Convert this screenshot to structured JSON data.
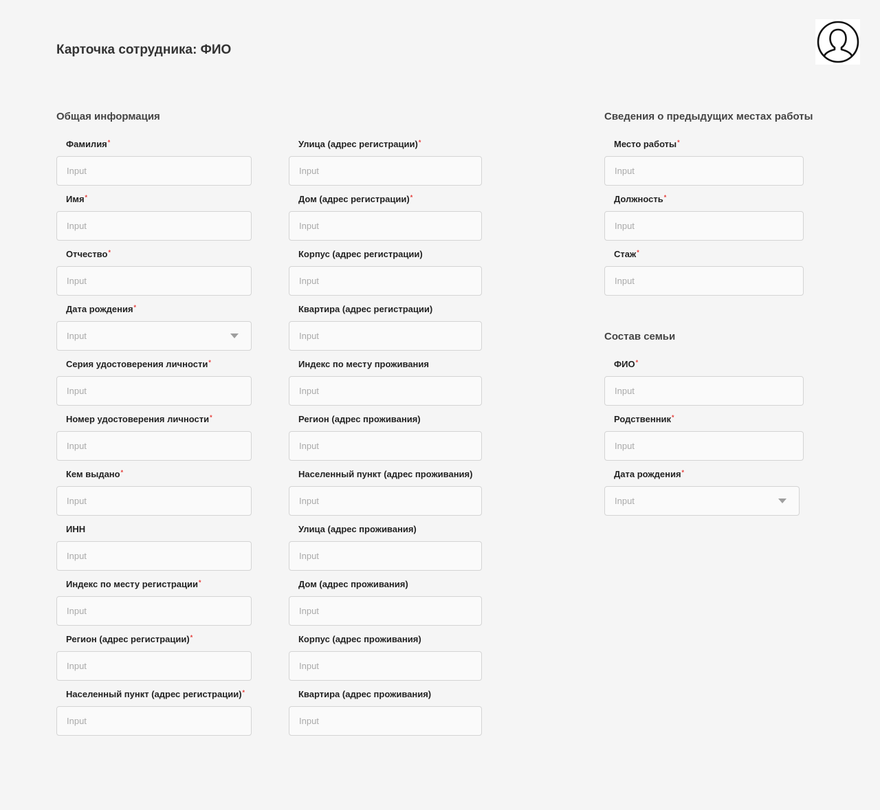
{
  "header": {
    "title": "Карточка сотрудника: ФИО"
  },
  "avatar": {
    "icon": "user-icon"
  },
  "placeholder": "Input",
  "general": {
    "title": "Общая информация",
    "fields": [
      {
        "label": "Фамилия",
        "required": "*"
      },
      {
        "label": "Имя",
        "required": "*"
      },
      {
        "label": "Отчество",
        "required": "*"
      },
      {
        "label": "Дата рождения",
        "required": "*"
      },
      {
        "label": "Серия удостоверения личности",
        "required": "*"
      },
      {
        "label": "Номер удостоверения личности",
        "required": "*"
      },
      {
        "label": "Кем выдано",
        "required": "*"
      },
      {
        "label": "ИНН",
        "required": ""
      },
      {
        "label": "Индекс по месту регистрации",
        "required": "*"
      },
      {
        "label": "Регион (адрес регистрации)",
        "required": "*"
      },
      {
        "label": "Населенный пункт (адрес регистрации)",
        "required": "*"
      }
    ]
  },
  "address": {
    "fields": [
      {
        "label": "Улица (адрес регистрации)",
        "required": "*"
      },
      {
        "label": "Дом (адрес регистрации)",
        "required": "*"
      },
      {
        "label": "Корпус (адрес регистрации)",
        "required": ""
      },
      {
        "label": "Квартира (адрес регистрации)",
        "required": ""
      },
      {
        "label": "Индекс по месту проживания",
        "required": ""
      },
      {
        "label": "Регион (адрес проживания)",
        "required": ""
      },
      {
        "label": "Населенный пункт (адрес проживания)",
        "required": ""
      },
      {
        "label": "Улица (адрес проживания)",
        "required": ""
      },
      {
        "label": "Дом (адрес проживания)",
        "required": ""
      },
      {
        "label": "Корпус (адрес проживания)",
        "required": ""
      },
      {
        "label": "Квартира (адрес проживания)",
        "required": ""
      }
    ]
  },
  "work": {
    "title": "Сведения о предыдущих местах работы",
    "fields": [
      {
        "label": "Место работы",
        "required": "*"
      },
      {
        "label": "Должность",
        "required": "*"
      },
      {
        "label": "Стаж",
        "required": "*"
      }
    ]
  },
  "family": {
    "title": "Состав семьи",
    "fields": [
      {
        "label": "ФИО",
        "required": "*"
      },
      {
        "label": "Родственник",
        "required": "*"
      },
      {
        "label": "Дата рождения",
        "required": "*"
      }
    ]
  },
  "colors": {
    "required": "#e53935",
    "background": "#f5f5f5",
    "input_border": "#d4d4d4"
  }
}
